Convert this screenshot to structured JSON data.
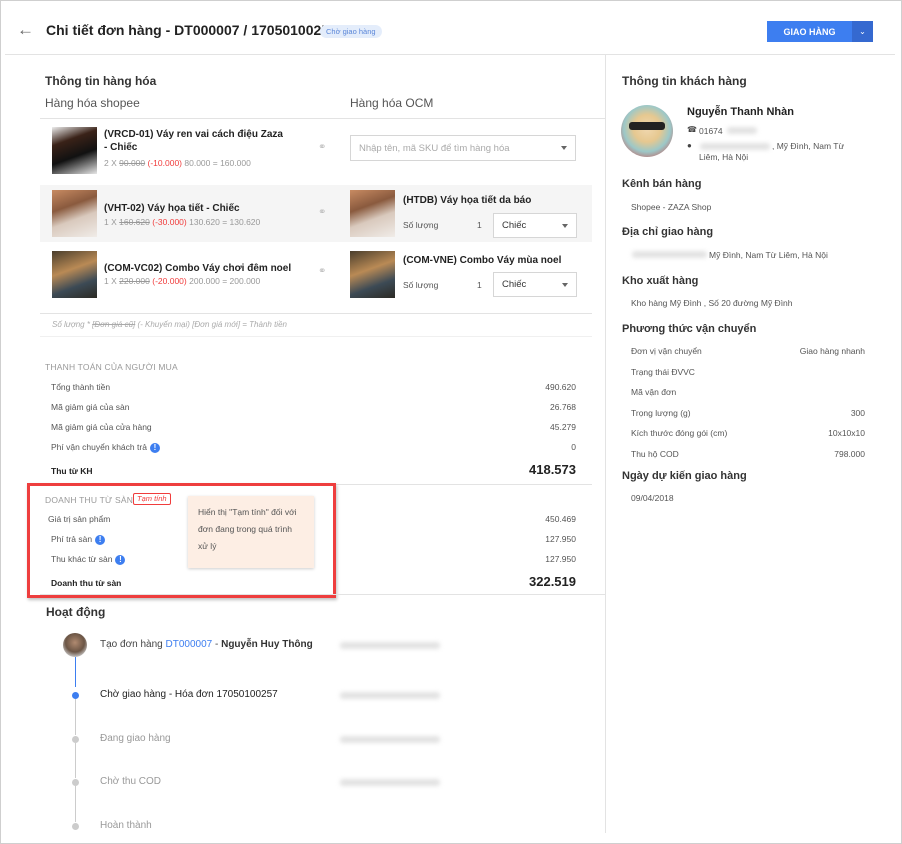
{
  "header": {
    "title": "Chi tiết đơn hàng - DT000007 / 17050100255",
    "status_badge": "Chờ giao hàng",
    "primary_button": "GIAO HÀNG"
  },
  "products": {
    "section_title": "Thông tin hàng hóa",
    "col_shopee": "Hàng hóa shopee",
    "col_ocm": "Hàng hóa OCM",
    "items": [
      {
        "name": "(VRCD-01) Váy ren vai cách điệu Zaza - Chiếc",
        "qty": "2 X",
        "old_price": "90.000",
        "discount": "(-10.000)",
        "new_total": "80.000 = 160.000",
        "ocm_placeholder": "Nhập tên, mã SKU để tìm hàng hóa"
      },
      {
        "name": "(VHT-02) Váy họa tiết - Chiếc",
        "qty": "1 X",
        "old_price": "160.620",
        "discount": "(-30.000)",
        "new_total": "130.620 = 130.620",
        "ocm_name": "(HTDB) Váy họa tiết da báo",
        "qty_label": "Số lượng",
        "ocm_qty": "1",
        "unit": "Chiếc"
      },
      {
        "name": "(COM-VC02) Combo Váy chơi đêm noel",
        "qty": "1 X",
        "old_price": "220.000",
        "discount": "(-20.000)",
        "new_total": "200.000 = 200.000",
        "ocm_name": "(COM-VNE) Combo Váy mùa noel",
        "qty_label": "Số lượng",
        "ocm_qty": "1",
        "unit": "Chiếc"
      }
    ],
    "formula_a": "Số lượng * ",
    "formula_b": "[Đơn giá cũ]",
    "formula_c": " (- Khuyến mại) [Đơn giá mới] = Thành tiền"
  },
  "buyer_payment": {
    "title": "THANH TOÁN CỦA NGƯỜI MUA",
    "rows": [
      {
        "label": "Tổng thành tiền",
        "value": "490.620"
      },
      {
        "label": "Mã giảm giá của sàn",
        "value": "26.768"
      },
      {
        "label": "Mã giảm giá của cửa hàng",
        "value": "45.279"
      },
      {
        "label": "Phí vận chuyển khách trả",
        "value": "0"
      }
    ],
    "total_label": "Thu từ KH",
    "total_value": "418.573"
  },
  "revenue": {
    "title": "DOANH THU TỪ SÀN",
    "badge": "Tạm tính",
    "rows": [
      {
        "label": "Giá trị sản phẩm",
        "value": "450.469"
      },
      {
        "label": "Phí trả sàn",
        "value": "127.950"
      },
      {
        "label": "Thu khác từ sàn",
        "value": "127.950"
      }
    ],
    "total_label": "Doanh thu từ sàn",
    "total_value": "322.519",
    "tooltip": "Hiển thị \"Tạm tính\" đối với đơn đang trong quá trình xử lý",
    "info_glyph": "!"
  },
  "activity": {
    "title": "Hoạt động",
    "created_prefix": "Tạo đơn hàng ",
    "created_link": "DT000007",
    "created_suffix": " - ",
    "created_by": "Nguyễn Huy Thông",
    "steps": [
      "Chờ giao hàng - Hóa đơn 17050100257",
      "Đang giao hàng",
      "Chờ thu COD",
      "Hoàn thành"
    ]
  },
  "customer": {
    "title": "Thông tin khách hàng",
    "name": "Nguyễn Thanh Nhàn",
    "phone": "01674",
    "address_line1": ", Mỹ Đình, Nam Từ",
    "address_line2": "Liêm, Hà Nội",
    "channel_title": "Kênh bán hàng",
    "channel": "Shopee - ZAZA Shop",
    "ship_addr_title": "Địa chỉ giao hàng",
    "ship_addr": "Mỹ Đình, Nam Từ Liêm, Hà Nội",
    "warehouse_title": "Kho xuất hàng",
    "warehouse": "Kho hàng Mỹ Đình , Số 20 đường Mỹ Đình",
    "shipping_title": "Phương thức vận chuyển",
    "shipping_rows": [
      {
        "label": "Đơn vị vận chuyển",
        "value": "Giao hàng nhanh"
      },
      {
        "label": "Trạng thái ĐVVC",
        "value": ""
      },
      {
        "label": "Mã vận đơn",
        "value": ""
      },
      {
        "label": "Trọng lượng (g)",
        "value": "300"
      },
      {
        "label": "Kích thước đóng gói (cm)",
        "value": "10x10x10"
      },
      {
        "label": "Thu hộ COD",
        "value": "798.000"
      }
    ],
    "eta_title": "Ngày dự kiến giao hàng",
    "eta": "09/04/2018"
  },
  "colors": {
    "accent": "#3d7ef0",
    "danger": "#f03c3c",
    "tooltip_bg": "#fdeee4"
  }
}
